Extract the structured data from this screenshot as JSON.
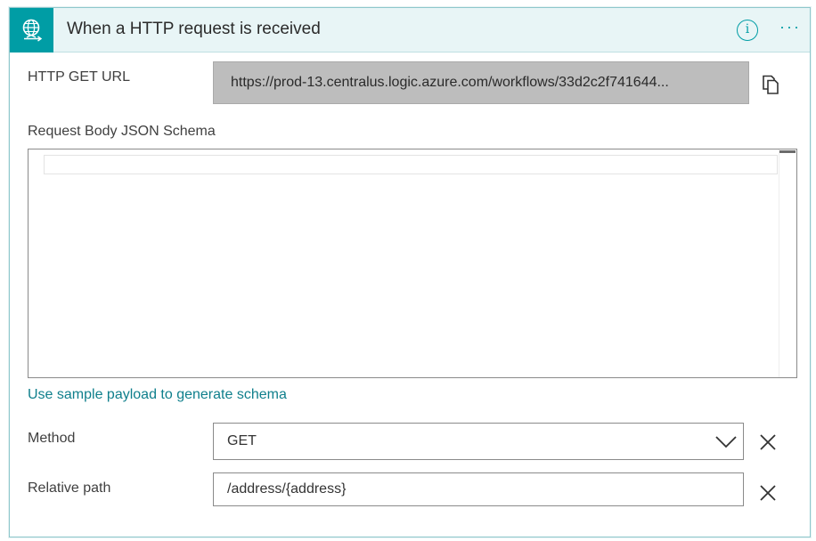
{
  "header": {
    "title": "When a HTTP request is received",
    "trigger_icon": "http-request-globe-icon",
    "info_icon": "info-icon",
    "info_glyph": "i",
    "more_icon": "ellipsis-icon",
    "more_glyph": "···"
  },
  "http_get_url": {
    "label": "HTTP GET URL",
    "value": "https://prod-13.centralus.logic.azure.com/workflows/33d2c2f741644...",
    "copy_icon": "copy-icon"
  },
  "schema": {
    "label": "Request Body JSON Schema",
    "value": ""
  },
  "sample_payload_link": "Use sample payload to generate schema",
  "method": {
    "label": "Method",
    "selected": "GET",
    "dropdown_icon": "chevron-down-icon",
    "clear_icon": "close-icon"
  },
  "relative_path": {
    "label": "Relative path",
    "value": "/address/{address}",
    "clear_icon": "close-icon"
  },
  "colors": {
    "accent": "#009da5",
    "header_bg": "#e8f5f6",
    "link": "#0f7f8c",
    "url_box_bg": "#bdbdbd"
  }
}
